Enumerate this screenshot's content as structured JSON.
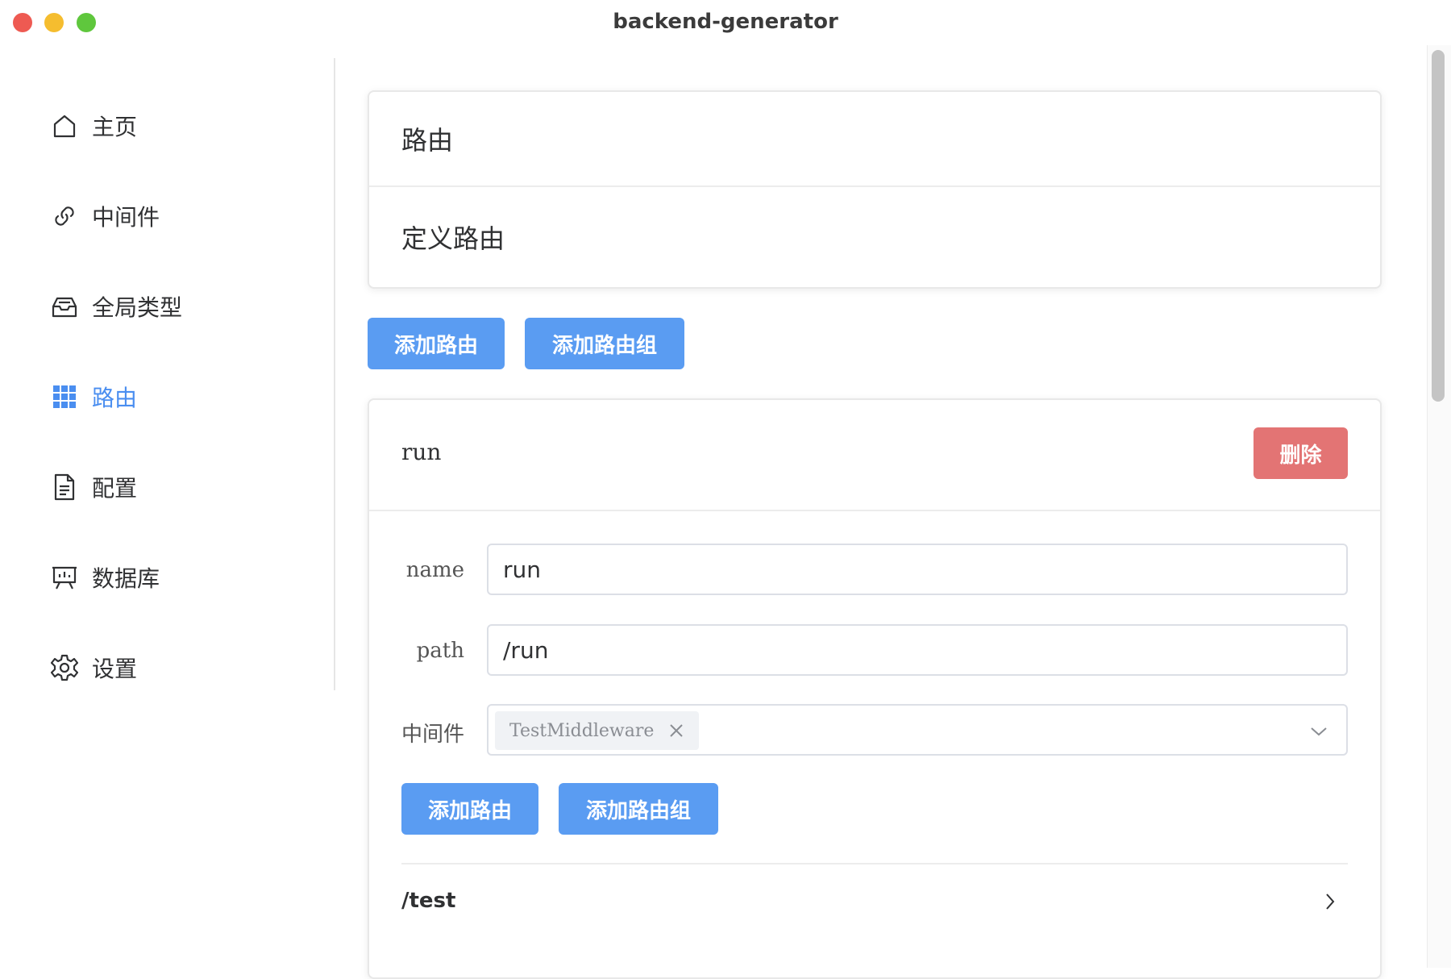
{
  "window": {
    "title": "backend-generator"
  },
  "sidebar": {
    "items": [
      {
        "label": "主页",
        "icon": "home-icon"
      },
      {
        "label": "中间件",
        "icon": "link-icon"
      },
      {
        "label": "全局类型",
        "icon": "inbox-icon"
      },
      {
        "label": "路由",
        "icon": "grid-icon",
        "active": true
      },
      {
        "label": "配置",
        "icon": "document-icon"
      },
      {
        "label": "数据库",
        "icon": "presentation-icon"
      },
      {
        "label": "设置",
        "icon": "gear-icon"
      }
    ]
  },
  "header_card": {
    "title": "路由",
    "subtitle": "定义路由"
  },
  "toolbar": {
    "add_route": "添加路由",
    "add_route_group": "添加路由组"
  },
  "route": {
    "name": "run",
    "delete_label": "删除",
    "form": {
      "name_label": "name",
      "name_value": "run",
      "path_label": "path",
      "path_value": "/run",
      "middleware_label": "中间件",
      "middleware_tags": [
        "TestMiddleware"
      ]
    },
    "add_route": "添加路由",
    "add_route_group": "添加路由组",
    "children": [
      {
        "path": "/test"
      }
    ]
  },
  "colors": {
    "primary": "#5a9cf2",
    "danger": "#e37474",
    "active_text": "#4a8ef0"
  }
}
